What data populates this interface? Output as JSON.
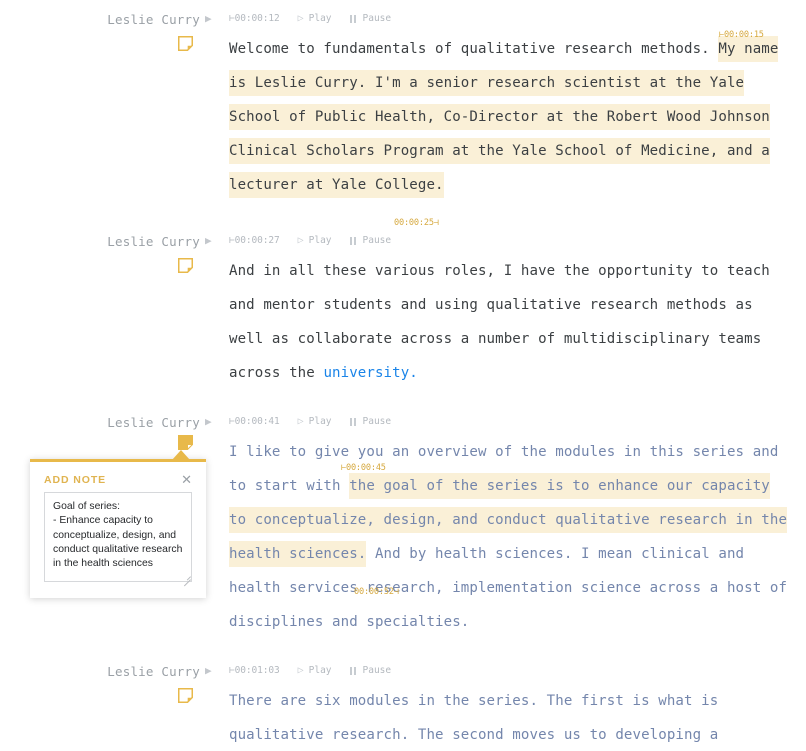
{
  "colors": {
    "highlight_bg": "#faf0d7",
    "marker": "#d6a93f",
    "note_accent": "#e8b94a",
    "link": "#1a84e8",
    "text_dark": "#3c4043",
    "text_blue": "#7486ac",
    "muted": "#b4b9bf"
  },
  "controls": {
    "play_label": "Play",
    "pause_label": "Pause",
    "play_icon": "play-triangle-icon",
    "pause_icon": "pause-bars-icon"
  },
  "note_popup": {
    "title": "ADD NOTE",
    "close_icon": "close-icon",
    "note_text": "Goal of series:\n- Enhance capacity to conceptualize, design, and conduct qualitative research in the health sciences",
    "placeholder": ""
  },
  "segments": [
    {
      "speaker": "Leslie Curry",
      "speaker_play_icon": "play-triangle-icon",
      "start_time": "00:00:12",
      "note_icon": "note-icon",
      "note_active": false,
      "highlight_start_marker": "⊢00:00:15",
      "highlight_end_marker": "00:00:25⊣",
      "text_color": "dark",
      "parts": [
        {
          "text": "Welcome to fundamentals of qualitative research methods. ",
          "style": "plain"
        },
        {
          "text": "My name is Leslie Curry. I'm a senior research scientist at the Yale School of Public Health, Co-Director at the Robert Wood Johnson Clinical Scholars Program at the Yale School of Medicine, and a lecturer at Yale College.",
          "style": "highlight"
        }
      ]
    },
    {
      "speaker": "Leslie Curry",
      "speaker_play_icon": "play-triangle-icon",
      "start_time": "00:00:27",
      "note_icon": "note-icon",
      "note_active": false,
      "text_color": "dark",
      "parts": [
        {
          "text": "And in all these various roles, I have the opportunity to teach and mentor students and using qualitative research methods as well as collaborate across a number of multidisciplinary teams across the ",
          "style": "plain"
        },
        {
          "text": "university.",
          "style": "link"
        }
      ]
    },
    {
      "speaker": "Leslie Curry",
      "speaker_play_icon": "play-triangle-icon",
      "start_time": "00:00:41",
      "note_icon": "note-icon-active",
      "note_active": true,
      "highlight_start_marker": "⊢00:00:45",
      "highlight_end_marker": "00:00:52⊣",
      "text_color": "blue",
      "parts": [
        {
          "text": "I like to give you an overview of the modules in this series and to start with ",
          "style": "plain"
        },
        {
          "text": "the goal of the series is to enhance our capacity to conceptualize, design, and conduct qualitative research in the health sciences.",
          "style": "highlight"
        },
        {
          "text": " And by health sciences. I mean clinical and health services research, implementation science across a host of disciplines and specialties.",
          "style": "plain"
        }
      ]
    },
    {
      "speaker": "Leslie Curry",
      "speaker_play_icon": "play-triangle-icon",
      "start_time": "00:01:03",
      "note_icon": "note-icon",
      "note_active": false,
      "text_color": "blue",
      "parts": [
        {
          "text": "There are six modules in the series. The first is what is qualitative research. The second moves us to developing a",
          "style": "plain"
        }
      ]
    }
  ]
}
